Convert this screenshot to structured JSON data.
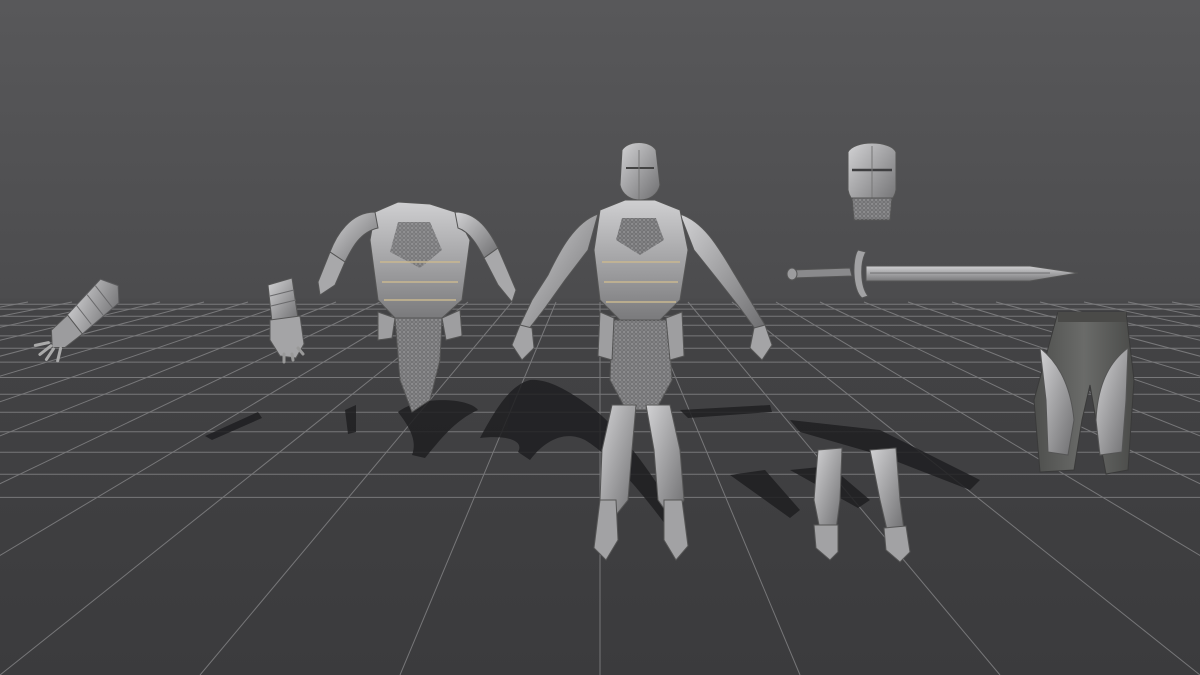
{
  "viewport": {
    "background_top": "#5a5a5c",
    "background_horizon": "#4b4b4d",
    "floor_color": "#3e3e40",
    "grid_color": "#8a8a8c"
  },
  "armor_color": {
    "metal_light": "#c4c4c6",
    "metal_mid": "#9a9a9c",
    "metal_dark": "#6a6a6c",
    "cloth": "#5c5d5b",
    "shadow": "#1f1f21"
  },
  "objects": [
    {
      "name": "left-gauntlet",
      "icon": "gauntlet-icon"
    },
    {
      "name": "right-gauntlet",
      "icon": "gauntlet-icon"
    },
    {
      "name": "cuirass-with-pauldrons",
      "icon": "chestplate-icon"
    },
    {
      "name": "full-knight-armor",
      "icon": "knight-icon"
    },
    {
      "name": "great-helm",
      "icon": "helmet-icon"
    },
    {
      "name": "longsword",
      "icon": "sword-icon"
    },
    {
      "name": "greaves-pair",
      "icon": "boots-icon"
    },
    {
      "name": "armored-trousers",
      "icon": "trousers-icon"
    }
  ]
}
